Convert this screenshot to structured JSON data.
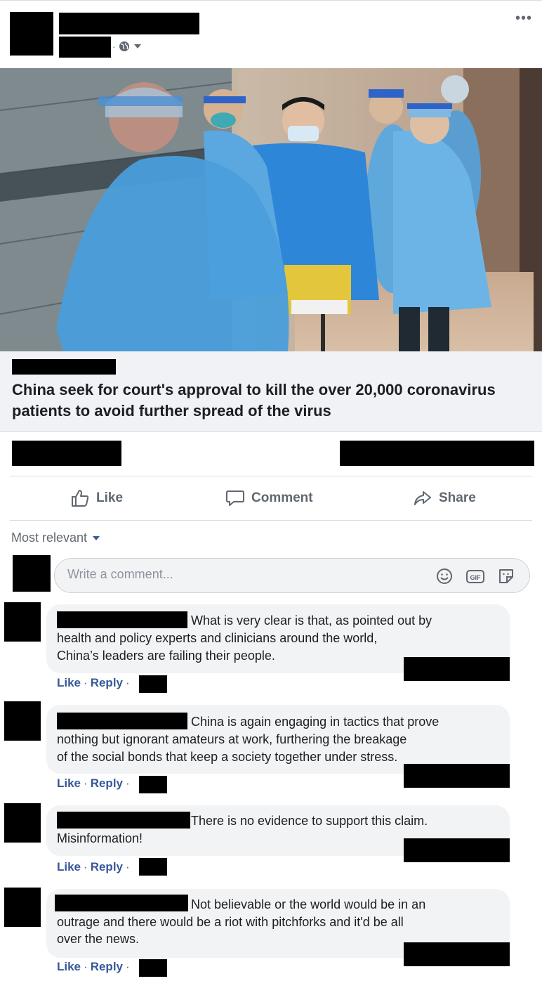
{
  "header": {
    "more_label": "•••"
  },
  "link_preview": {
    "title": "China seek for court's approval to kill the over 20,000 coronavirus patients to avoid further spread of the virus"
  },
  "actions": {
    "like": "Like",
    "comment": "Comment",
    "share": "Share"
  },
  "comments_section": {
    "sort_label": "Most relevant",
    "input_placeholder": "Write a comment..."
  },
  "comments": [
    {
      "lines": [
        "What is very clear is that, as pointed out by",
        "health and policy experts and clinicians around the world,",
        "China’s leaders are failing their people."
      ],
      "like": "Like",
      "reply": "Reply"
    },
    {
      "lines": [
        "China is again engaging in tactics that prove",
        "nothing but ignorant amateurs at work, furthering the breakage",
        "of the social bonds that keep a society together under stress."
      ],
      "like": "Like",
      "reply": "Reply"
    },
    {
      "lines": [
        "There is no evidence to support this claim.",
        "Misinformation!"
      ],
      "like": "Like",
      "reply": "Reply"
    },
    {
      "lines": [
        "Not believable or the world would be in an",
        "outrage and there would be a riot with pitchforks and it'd be all",
        "over the news."
      ],
      "like": "Like",
      "reply": "Reply"
    }
  ],
  "icons": {
    "more": "more-icon",
    "privacy": "globe-icon",
    "like": "thumbs-up-icon",
    "comment": "speech-bubble-icon",
    "share": "share-arrow-icon",
    "emoji": "emoji-icon",
    "gif": "gif-icon",
    "sticker": "sticker-icon"
  },
  "colors": {
    "link_blue": "#385898",
    "muted": "#606770",
    "bubble_bg": "#f2f3f5",
    "ppe_blue": "#4aa3de"
  }
}
